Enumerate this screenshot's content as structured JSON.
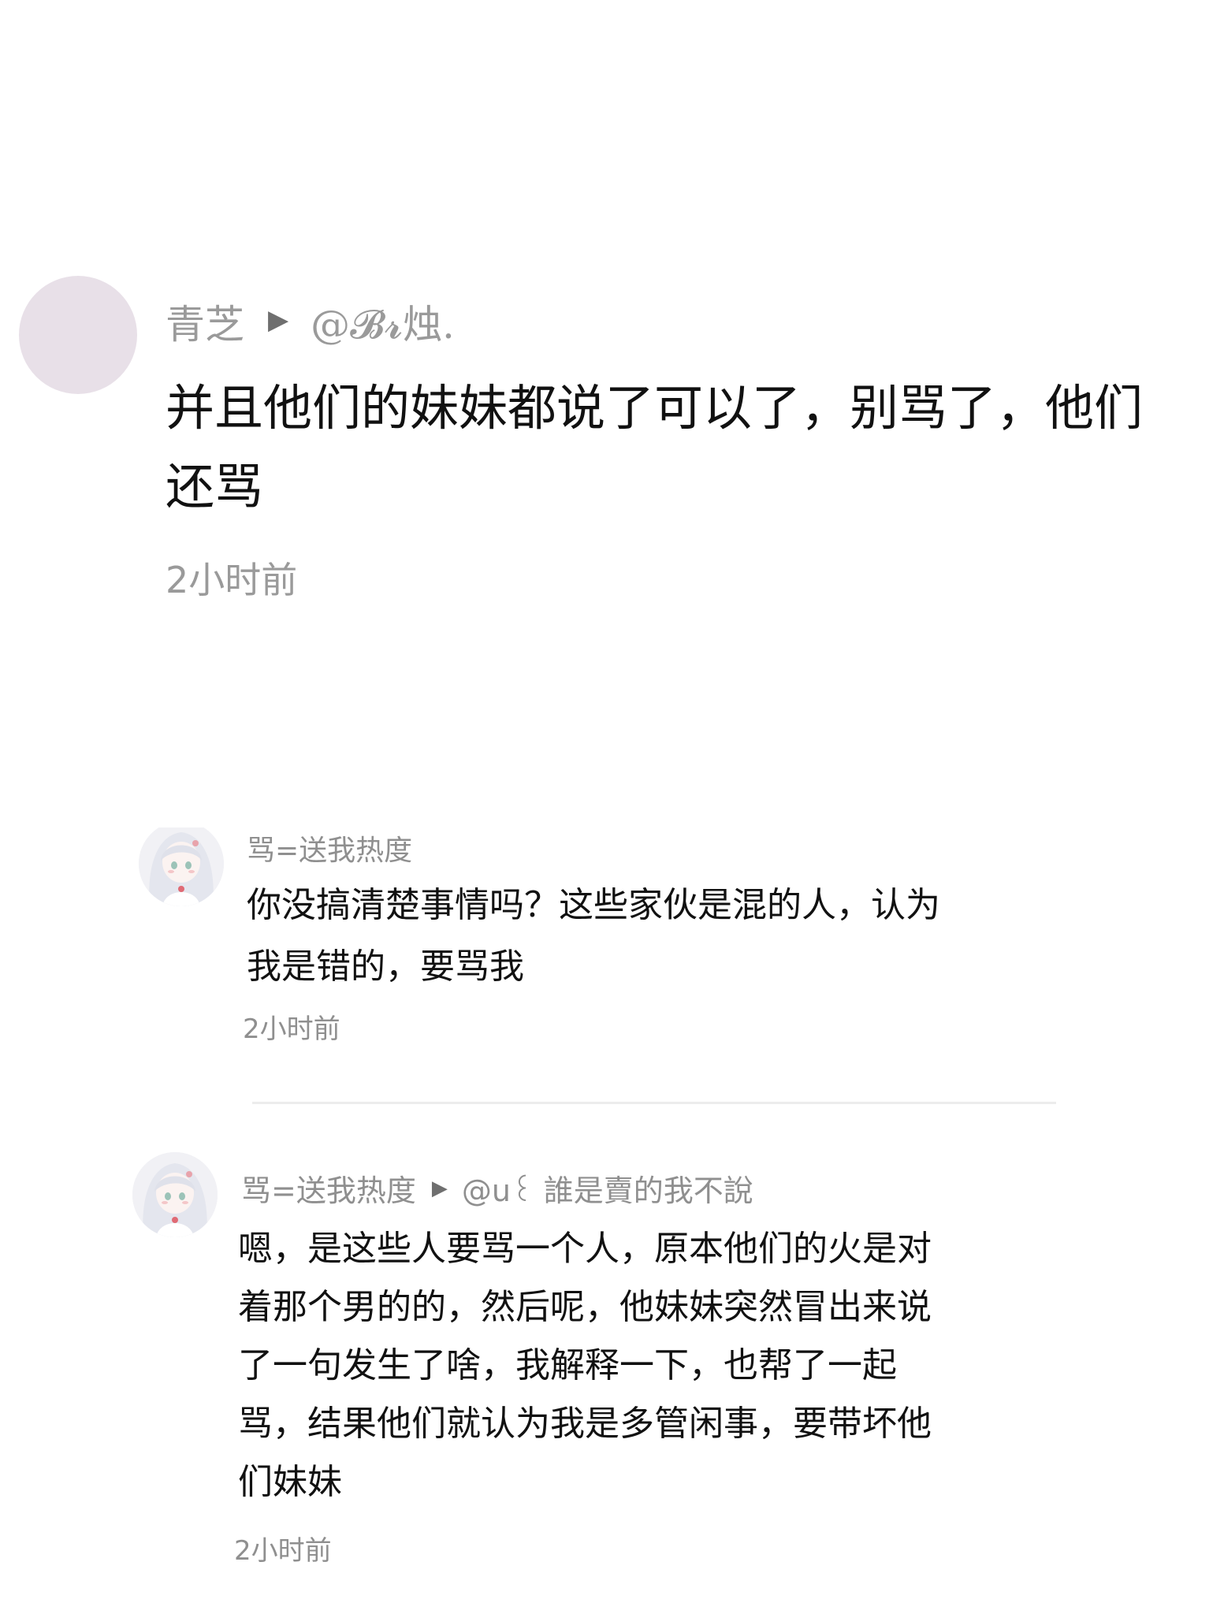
{
  "comments": [
    {
      "author": "青芝",
      "reply_to": "@𝓑𝓻烛.",
      "text_lines": [
        "并且他们的妹妹都说了可以了，别骂了，他们",
        "还骂"
      ],
      "time": "2小时前",
      "avatar": "pale-lavender-circle"
    },
    {
      "author": "骂=送我热度",
      "text_lines": [
        "你没搞清楚事情吗？这些家伙是混的人，认为",
        "我是错的，要骂我"
      ],
      "time": "2小时前",
      "avatar": "anime-girl-avatar"
    },
    {
      "author": "骂=送我热度",
      "reply_to": "@u꒰ 誰是賣的我不說",
      "text_lines": [
        "嗯，是这些人要骂一个人，原本他们的火是对",
        "着那个男的的，然后呢，他妹妹突然冒出来说",
        "了一句发生了啥，我解释一下，也帮了一起",
        "骂，结果他们就认为我是多管闲事，要带坏他",
        "们妹妹"
      ],
      "time": "2小时前",
      "avatar": "anime-girl-avatar"
    }
  ],
  "reply_arrow_icon": "play-triangle-icon"
}
